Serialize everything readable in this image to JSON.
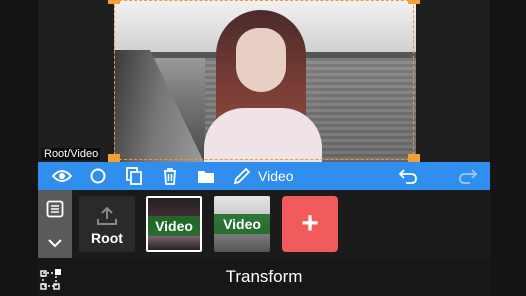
{
  "preview": {
    "layer_path": "Root/Video"
  },
  "toolbar": {
    "icons": [
      "eye-icon",
      "circle-icon",
      "copy-icon",
      "trash-icon",
      "folder-icon",
      "pencil-icon"
    ],
    "title": "Video",
    "undo_icon": "undo-icon",
    "redo_icon": "redo-icon"
  },
  "layers": {
    "root_label": "Root",
    "items": [
      {
        "label": "Video"
      },
      {
        "label": "Video"
      }
    ],
    "add_label": "+"
  },
  "bottom": {
    "title": "Transform"
  },
  "colors": {
    "toolbar": "#2f8eee",
    "handle": "#f2a030",
    "add_button": "#f25b5b",
    "video_label_bg": "#1e6e28"
  }
}
